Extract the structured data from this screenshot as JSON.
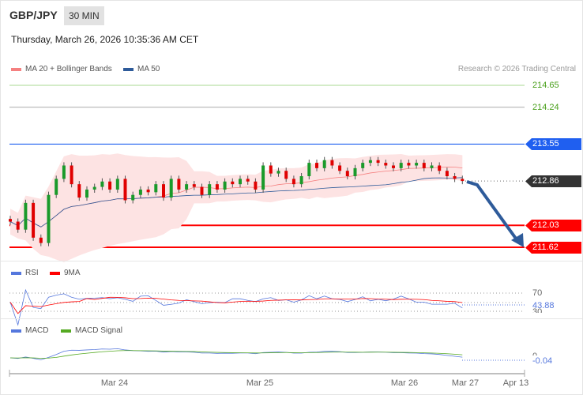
{
  "header": {
    "symbol": "GBP/JPY",
    "timeframe": "30 MIN",
    "datetime": "Thursday, March 26, 2026 10:35:36 AM CET"
  },
  "legend": {
    "ma20": "MA 20 + Bollinger Bands",
    "ma50": "MA 50",
    "credit": "Research © 2026 Trading Central"
  },
  "colors": {
    "ma20": "#f58080",
    "ma50": "#2e5b9a",
    "resistance": "#1f5ff0",
    "support": "#ff0000",
    "target_up": "#6fbf40",
    "current": "#333333",
    "arrow": "#2e5b9a",
    "rsi": "#5577dd",
    "rsi_ma": "#ff0000",
    "macd": "#5577dd",
    "macd_signal": "#55aa22"
  },
  "chart_data": {
    "type": "candlestick",
    "title": "GBP/JPY 30 MIN",
    "x_ticks": [
      "Mar 24",
      "Mar 25",
      "Mar 26",
      "Mar 27",
      "Apr 13"
    ],
    "ylim": [
      211.62,
      214.65
    ],
    "levels": {
      "target_2": "214.65",
      "target_1": "214.24",
      "resistance": "213.55",
      "current": "212.86",
      "support_1": "212.03",
      "support_2": "211.62"
    },
    "closes": [
      212.1,
      211.95,
      212.45,
      211.8,
      211.7,
      212.6,
      212.9,
      213.15,
      212.8,
      212.55,
      212.7,
      212.75,
      212.85,
      212.7,
      212.9,
      212.5,
      212.6,
      212.7,
      212.65,
      212.8,
      212.55,
      212.9,
      212.7,
      212.8,
      212.75,
      212.6,
      212.8,
      212.7,
      212.85,
      212.8,
      212.9,
      212.85,
      212.7,
      213.15,
      213.0,
      213.05,
      212.9,
      212.8,
      212.95,
      213.2,
      213.1,
      213.25,
      213.15,
      213.05,
      212.95,
      213.1,
      213.2,
      213.25,
      213.2,
      213.15,
      213.1,
      213.2,
      213.15,
      213.2,
      213.1,
      213.15,
      213.05,
      212.95,
      212.9,
      212.86
    ],
    "rsi": {
      "label": "RSI",
      "ma_label": "9MA",
      "upper": "70",
      "lower": "30",
      "value": "43.88"
    },
    "macd": {
      "label": "MACD",
      "signal_label": "MACD Signal",
      "zero": "0",
      "value": "-0.04"
    }
  }
}
